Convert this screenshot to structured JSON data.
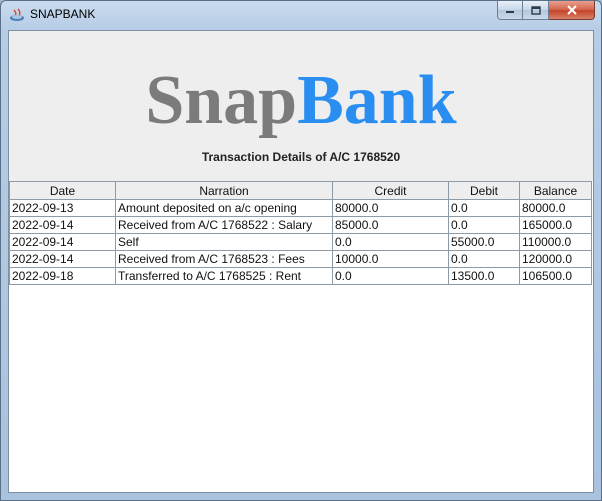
{
  "window": {
    "title": "SNAPBANK"
  },
  "header": {
    "logo_part1": "Snap",
    "logo_part2": "Bank",
    "subtitle": "Transaction Details of A/C 1768520",
    "colors": {
      "logo_part1": "#7b7b7b",
      "logo_part2": "#2a8ef0"
    }
  },
  "table": {
    "columns": [
      "Date",
      "Narration",
      "Credit",
      "Debit",
      "Balance"
    ],
    "rows": [
      {
        "date": "2022-09-13",
        "narration": "Amount deposited on a/c opening",
        "credit": "80000.0",
        "debit": "0.0",
        "balance": "80000.0"
      },
      {
        "date": "2022-09-14",
        "narration": "Received from A/C 1768522 : Salary",
        "credit": "85000.0",
        "debit": "0.0",
        "balance": "165000.0"
      },
      {
        "date": "2022-09-14",
        "narration": "Self",
        "credit": "0.0",
        "debit": "55000.0",
        "balance": "110000.0"
      },
      {
        "date": "2022-09-14",
        "narration": "Received from A/C 1768523 : Fees",
        "credit": "10000.0",
        "debit": "0.0",
        "balance": "120000.0"
      },
      {
        "date": "2022-09-18",
        "narration": "Transferred to A/C 1768525 : Rent",
        "credit": "0.0",
        "debit": "13500.0",
        "balance": "106500.0"
      }
    ]
  }
}
